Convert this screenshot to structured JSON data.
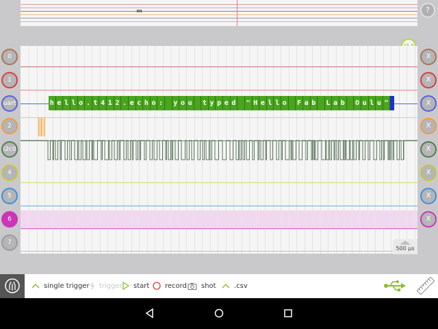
{
  "overview": {
    "lines": [
      {
        "color": "#d9a0a0"
      },
      {
        "color": "#e8a0a0"
      },
      {
        "color": "#7f7fd0"
      },
      {
        "color": "#f0c090"
      },
      {
        "color": "#9a9a9a"
      },
      {
        "color": "#c8c870"
      }
    ]
  },
  "help_label": "?",
  "time_badge": "15.5",
  "channels": [
    {
      "label": "0",
      "color": "#a8754e",
      "line_color": "#c07070"
    },
    {
      "label": "1",
      "color": "#dc3b3b",
      "line_color": "#e38a8a"
    },
    {
      "label": "uart",
      "color": "#5561d9",
      "line_color": "#5561d9"
    },
    {
      "label": "2",
      "color": "#f39a3a",
      "line_color": "#f3c48a"
    },
    {
      "label": "i2c0",
      "color": "#4b7f4b",
      "line_color": "#6a8a6a"
    },
    {
      "label": "4",
      "color": "#c8c82e",
      "line_color": "#d8d870"
    },
    {
      "label": "5",
      "color": "#3b8fe0",
      "line_color": "#6aa8e8"
    },
    {
      "label": "6",
      "color": "#cc35b8",
      "line_color": "#d565c5"
    },
    {
      "label": "7",
      "color": "#9a9a9a",
      "line_color": "#bdbdbd"
    }
  ],
  "clear_label": "X",
  "decoded_chars": [
    "h",
    "e",
    "l",
    "l",
    "o",
    ".",
    "t",
    "4",
    "1",
    "2",
    ".",
    "e",
    "c",
    "h",
    "o",
    ":",
    " ",
    "y",
    "o",
    "u",
    " ",
    "t",
    "y",
    "p",
    "e",
    "d",
    " ",
    "\"",
    "H",
    "e",
    "l",
    "l",
    "o",
    " ",
    "F",
    "a",
    "b",
    " ",
    "L",
    "a",
    "b",
    " ",
    "O",
    "u",
    "l",
    "u",
    "\""
  ],
  "scroll_label": "500 µs",
  "toolbar": {
    "single_trigger": "single trigger",
    "trigger": "trigger",
    "start": "start",
    "record": "record",
    "shot": "shot",
    "csv": ".csv"
  },
  "colors": {
    "accent": "#8dbd2e",
    "decoded_bg": "#48a51d",
    "record": "#dd3a3a"
  }
}
